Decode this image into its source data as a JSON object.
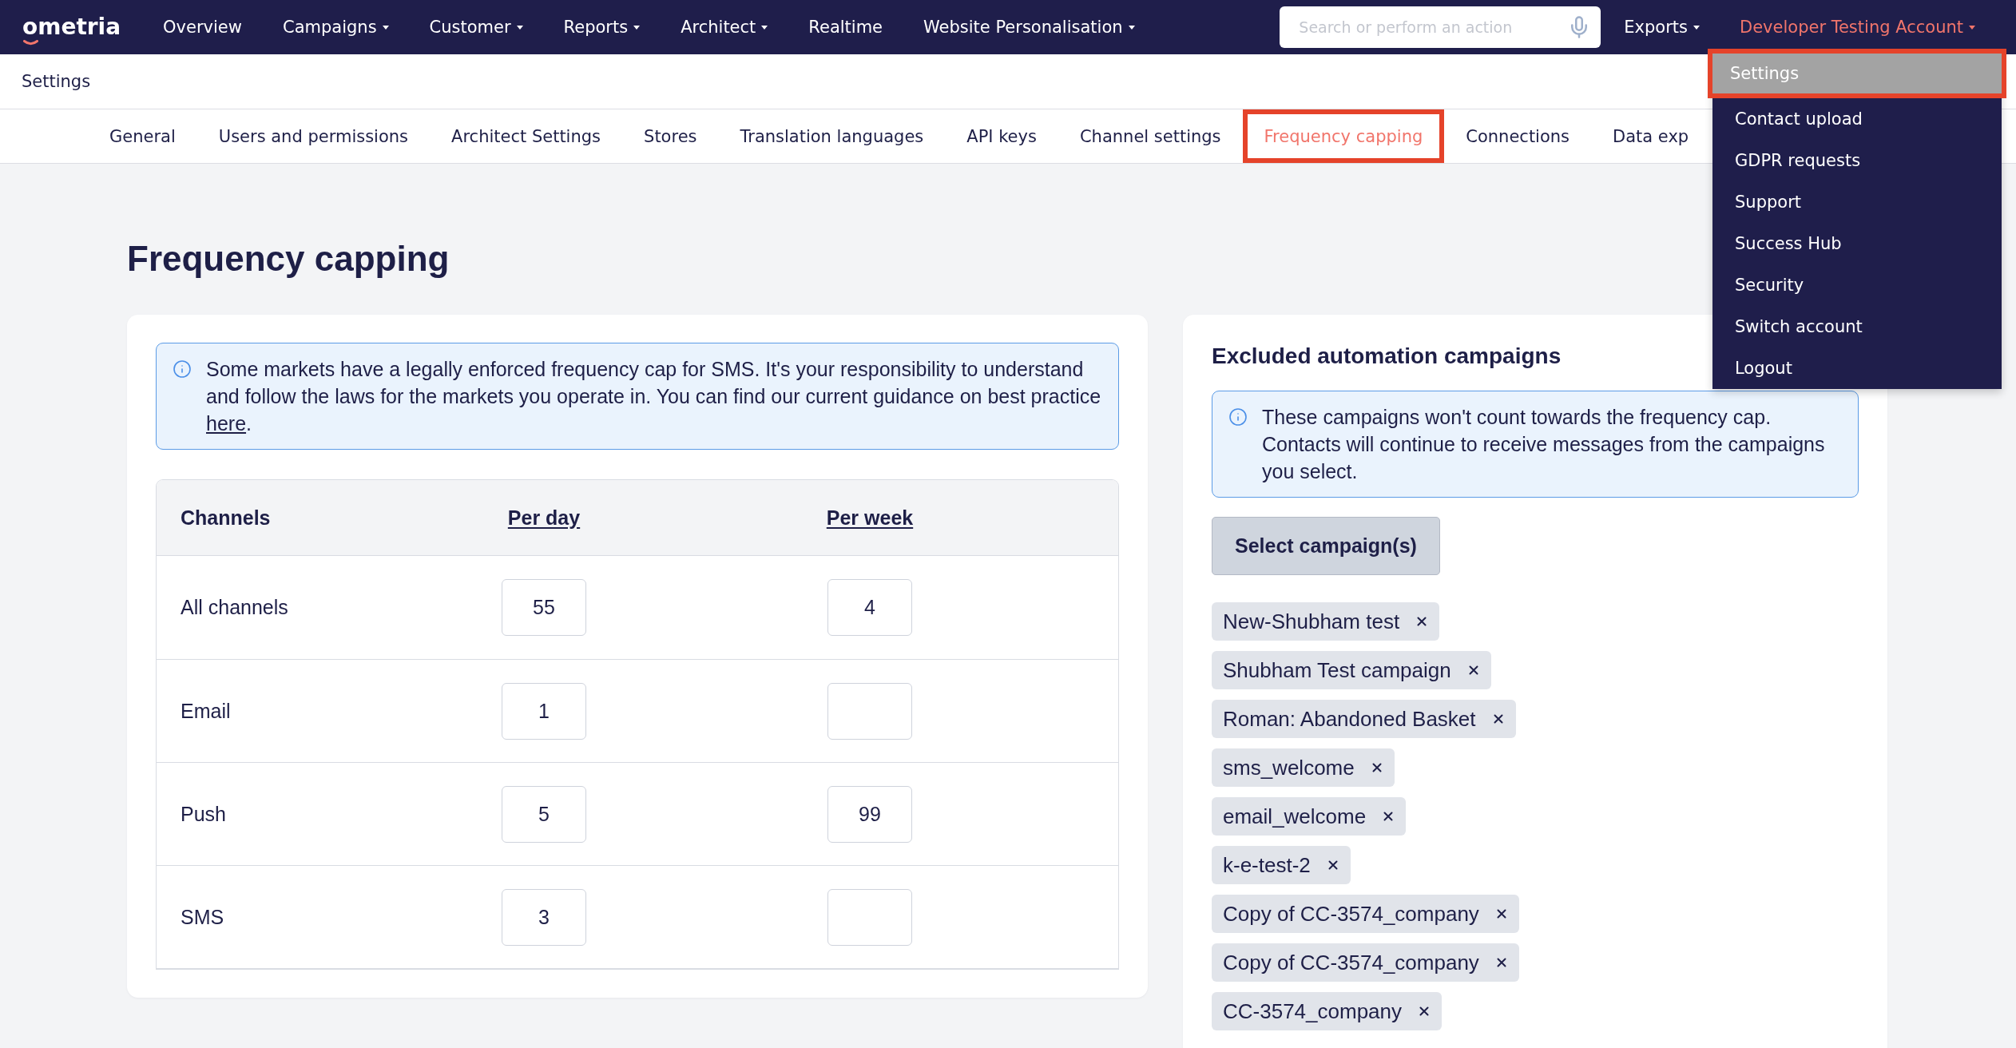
{
  "header": {
    "logo": "ometria",
    "nav": [
      {
        "label": "Overview",
        "has_menu": false
      },
      {
        "label": "Campaigns",
        "has_menu": true
      },
      {
        "label": "Customer",
        "has_menu": true
      },
      {
        "label": "Reports",
        "has_menu": true
      },
      {
        "label": "Architect",
        "has_menu": true
      },
      {
        "label": "Realtime",
        "has_menu": false
      },
      {
        "label": "Website Personalisation",
        "has_menu": true
      }
    ],
    "search": {
      "placeholder": "Search or perform an action"
    },
    "right_nav": [
      {
        "label": "Exports",
        "has_menu": true,
        "expanded": false
      },
      {
        "label": "Developer Testing Account",
        "has_menu": true,
        "expanded": true,
        "menu": [
          {
            "label": "Settings",
            "selected": true
          },
          {
            "label": "Contact upload",
            "selected": false
          },
          {
            "label": "GDPR requests",
            "selected": false
          },
          {
            "label": "Support",
            "selected": false
          },
          {
            "label": "Success Hub",
            "selected": false
          },
          {
            "label": "Security",
            "selected": false
          },
          {
            "label": "Switch account",
            "selected": false
          },
          {
            "label": "Logout",
            "selected": false
          }
        ]
      }
    ]
  },
  "breadcrumb": "Settings",
  "tabs": [
    {
      "label": "General",
      "selected": false
    },
    {
      "label": "Users and permissions",
      "selected": false
    },
    {
      "label": "Architect Settings",
      "selected": false
    },
    {
      "label": "Stores",
      "selected": false
    },
    {
      "label": "Translation languages",
      "selected": false
    },
    {
      "label": "API keys",
      "selected": false
    },
    {
      "label": "Channel settings",
      "selected": false
    },
    {
      "label": "Frequency capping",
      "selected": true
    },
    {
      "label": "Connections",
      "selected": false
    },
    {
      "label": "Data exp",
      "selected": false
    }
  ],
  "page_title": "Frequency capping",
  "frequency_caps": {
    "notice": {
      "text": "Some markets have a legally enforced frequency cap for SMS. It's your responsibility to understand and follow the laws for the markets you operate in. You can find our current guidance on best practice",
      "link": "here",
      "text_after": "."
    },
    "table": {
      "columns": [
        {
          "label": "Channels",
          "kind": "name"
        },
        {
          "label": "Per day",
          "kind": "limit"
        },
        {
          "label": "Per week",
          "kind": "limit"
        }
      ],
      "rows": [
        {
          "channel": "All channels",
          "per_day": "55",
          "per_week": "4"
        },
        {
          "channel": "Email",
          "per_day": "1"
        },
        {
          "channel": "Push",
          "per_day": "5",
          "per_week": "99"
        },
        {
          "channel": "SMS",
          "per_day": "3"
        }
      ]
    }
  },
  "excluded_campaigns": {
    "title": "Excluded automation campaigns",
    "notice": "These campaigns won't count towards the frequency cap. Contacts will continue to receive messages from the campaigns you select.",
    "button": "Select campaign(s)",
    "campaigns": [
      "New-Shubham test",
      "Shubham Test campaign",
      "Roman: Abandoned Basket",
      "sms_welcome",
      "email_welcome",
      "k-e-test-2",
      "Copy of CC-3574_company",
      "Copy of CC-3574_company",
      "CC-3574_company"
    ]
  }
}
